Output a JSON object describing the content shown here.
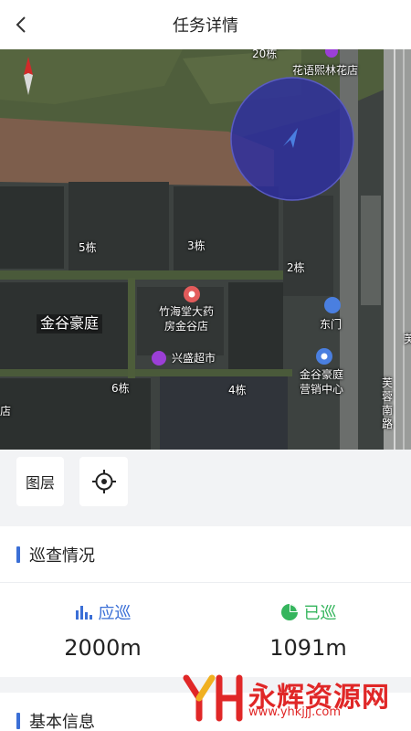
{
  "header": {
    "title": "任务详情"
  },
  "map": {
    "labels": {
      "bldg_20": "20栋",
      "florist": "花语熙林花店",
      "bldg_5": "5栋",
      "bldg_3": "3栋",
      "bldg_2": "2栋",
      "pharmacy_l1": "竹海堂大药",
      "pharmacy_l2": "房金谷店",
      "community": "金谷豪庭",
      "east_gate": "东门",
      "supermarket": "兴盛超市",
      "sales_l1": "金谷豪庭",
      "sales_l2": "营销中心",
      "bldg_6": "6栋",
      "bldg_4": "4栋",
      "road_right": "芙",
      "road_l1": "芙",
      "road_l2": "蓉",
      "road_l3": "南",
      "road_l4": "路",
      "shop_edge": "店"
    },
    "colors": {
      "range_circle": "#2e2f9e",
      "pin_red": "#e35b5b",
      "pin_blue": "#4a7fe0",
      "pin_purple": "#9b3fd6"
    }
  },
  "tools": {
    "layer_label": "图层"
  },
  "patrol": {
    "title": "巡查情况",
    "should_label": "应巡",
    "should_value": "2000m",
    "done_label": "已巡",
    "done_value": "1091m",
    "colors": {
      "should": "#3b6fd6",
      "done": "#35b55d"
    }
  },
  "basic": {
    "title": "基本信息"
  },
  "watermark": {
    "text": "永辉资源网",
    "url": "www.yhkjjj.com"
  }
}
